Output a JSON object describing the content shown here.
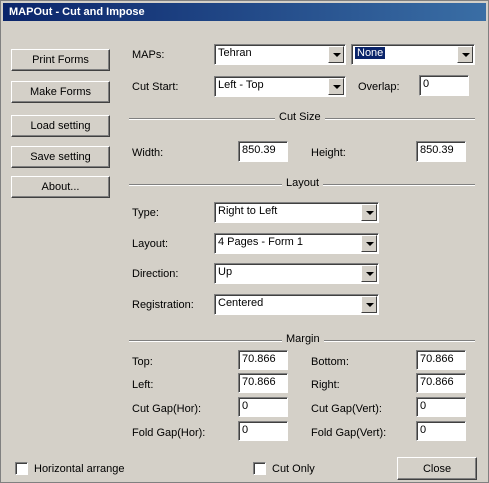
{
  "window": {
    "title": "MAPOut - Cut and Impose"
  },
  "sidebar": {
    "buttons": [
      {
        "label": "Print Forms"
      },
      {
        "label": "Make Forms"
      },
      {
        "label": "Load setting"
      },
      {
        "label": "Save setting"
      },
      {
        "label": "About..."
      }
    ]
  },
  "maps": {
    "label": "MAPs:",
    "value": "Tehran",
    "second_value": "None"
  },
  "cut_start": {
    "label": "Cut Start:",
    "value": "Left - Top"
  },
  "overlap": {
    "label": "Overlap:",
    "value": "0"
  },
  "cut_size": {
    "title": "Cut Size",
    "width_label": "Width:",
    "width_value": "850.39",
    "height_label": "Height:",
    "height_value": "850.39"
  },
  "layout": {
    "title": "Layout",
    "type_label": "Type:",
    "type_value": "Right to Left",
    "layout_label": "Layout:",
    "layout_value": "4 Pages - Form 1",
    "direction_label": "Direction:",
    "direction_value": "Up",
    "registration_label": "Registration:",
    "registration_value": "Centered"
  },
  "margin": {
    "title": "Margin",
    "top_label": "Top:",
    "top_value": "70.866",
    "bottom_label": "Bottom:",
    "bottom_value": "70.866",
    "left_label": "Left:",
    "left_value": "70.866",
    "right_label": "Right:",
    "right_value": "70.866",
    "cutgap_hor_label": "Cut Gap(Hor):",
    "cutgap_hor_value": "0",
    "cutgap_vert_label": "Cut Gap(Vert):",
    "cutgap_vert_value": "0",
    "foldgap_hor_label": "Fold Gap(Hor):",
    "foldgap_hor_value": "0",
    "foldgap_vert_label": "Fold Gap(Vert):",
    "foldgap_vert_value": "0"
  },
  "footer": {
    "horizontal_arrange_label": "Horizontal arrange",
    "cut_only_label": "Cut Only",
    "close_label": "Close"
  }
}
